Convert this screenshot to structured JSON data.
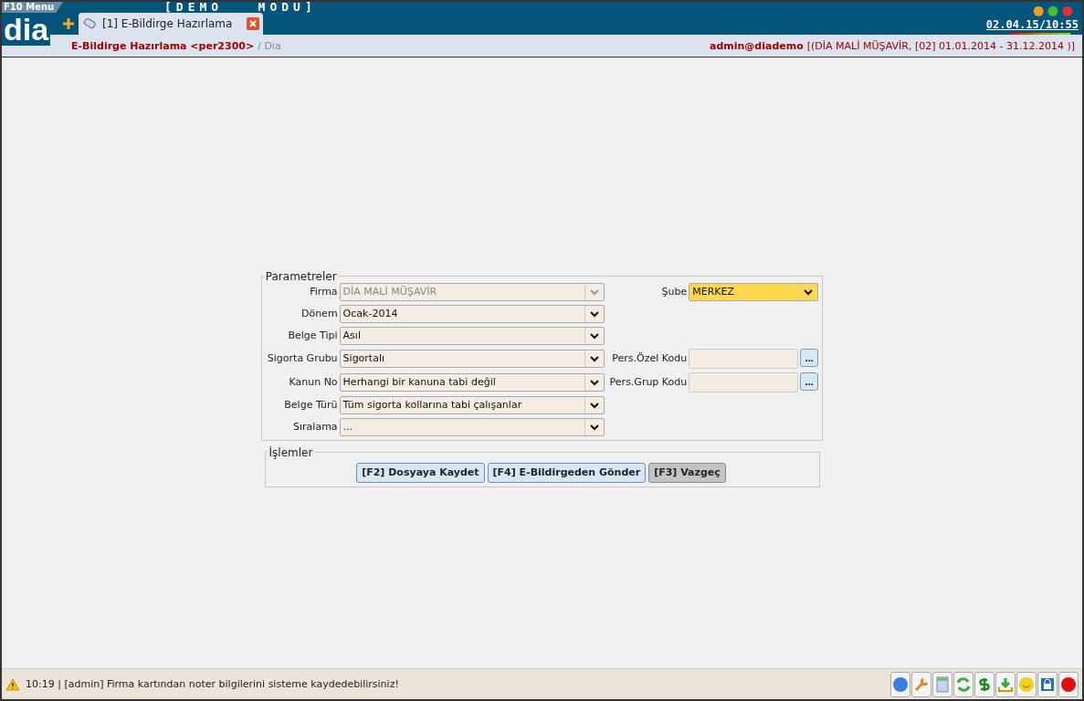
{
  "header": {
    "menu_label": "F10 Menu",
    "mode": "[DEMO   MODU]",
    "logo": "dia",
    "clock": "02.04.15/10:55"
  },
  "tabs": [
    {
      "label": "[1] E-Bildirge Hazırlama",
      "selected": true
    }
  ],
  "breadcrumb": {
    "title": "E-Bildirge Hazırlama <per2300>",
    "path": "/ Dia",
    "user": "admin@diademo",
    "context": "[(DİA MALİ MÜŞAVİR, [02] 01.01.2014 - 31.12.2014 )]"
  },
  "parameters": {
    "legend": "Parametreler",
    "rows": [
      {
        "left": {
          "label": "Firma",
          "value": "DİA MALİ MÜŞAVİR",
          "disabled": true
        },
        "right": {
          "kind": "combo",
          "label": "Şube",
          "value": "MERKEZ",
          "focused": true
        }
      },
      {
        "left": {
          "label": "Dönem",
          "value": "Ocak-2014",
          "disabled": false
        }
      },
      {
        "left": {
          "label": "Belge Tipi",
          "value": "Asıl",
          "disabled": false
        }
      },
      {
        "left": {
          "label": "Sigorta Grubu",
          "value": "Sigortalı",
          "disabled": false
        },
        "right": {
          "kind": "lookup",
          "label": "Pers.Özel Kodu",
          "button": "...",
          "focused": false
        }
      },
      {
        "left": {
          "label": "Kanun No",
          "value": "Herhangi bir kanuna tabi değil",
          "disabled": false
        },
        "right": {
          "kind": "lookup",
          "label": "Pers.Grup Kodu",
          "button": "...",
          "focused": false
        }
      },
      {
        "left": {
          "label": "Belge Türü",
          "value": "Tüm sigorta kollarına tabi çalışanlar",
          "disabled": false
        }
      },
      {
        "left": {
          "label": "Sıralama",
          "value": "...",
          "disabled": false
        }
      }
    ]
  },
  "actions": {
    "legend": "İşlemler",
    "buttons": [
      {
        "label": "[F2] Dosyaya Kaydet",
        "kind": "normal"
      },
      {
        "label": "[F4] E-Bildirgeden Gönder",
        "kind": "normal"
      },
      {
        "label": "[F3] Vazgeç",
        "kind": "cancel"
      }
    ]
  },
  "status_bar": {
    "message": "10:19 | [admin] Firma kartından noter bilgilerini sisteme kaydedebilirsiniz!"
  }
}
